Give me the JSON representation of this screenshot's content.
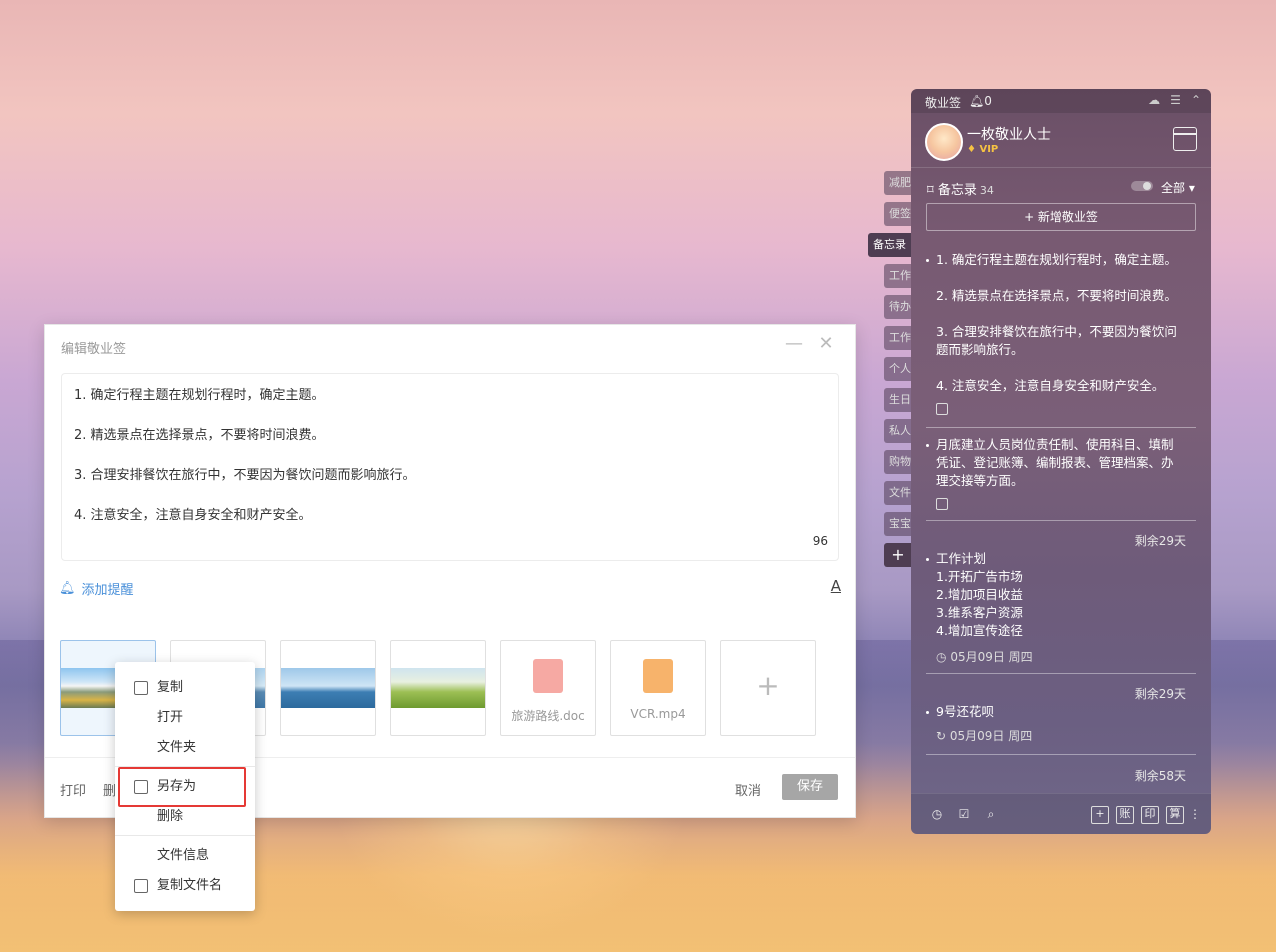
{
  "editor": {
    "title": "编辑敬业签",
    "lines": [
      "1. 确定行程主题在规划行程时，确定主题。",
      "2. 精选景点在选择景点，不要将时间浪费。",
      "3. 合理安排餐饮在旅行中，不要因为餐饮问题而影响旅行。",
      "4. 注意安全，注意自身安全和财产安全。"
    ],
    "char_count": "96",
    "add_reminder": "添加提醒",
    "font_button": "A",
    "attachments": [
      {
        "type": "image",
        "scene": "mountain"
      },
      {
        "type": "image",
        "scene": "sea"
      },
      {
        "type": "image",
        "scene": "boat"
      },
      {
        "type": "image",
        "scene": "field"
      },
      {
        "type": "file",
        "name": "旅游路线.doc",
        "icon": "doc-icon"
      },
      {
        "type": "file",
        "name": "VCR.mp4",
        "icon": "video-icon"
      }
    ],
    "add_attachment": "+",
    "print": "打印",
    "delete_partial": "删",
    "cancel": "取消",
    "save": "保存",
    "colors": {
      "doc": "#f28b82",
      "video": "#f5a04a",
      "link": "#4a90d9",
      "save_bg": "#a6a6a6"
    }
  },
  "context_menu": {
    "items": [
      "复制",
      "打开",
      "文件夹",
      "另存为",
      "删除",
      "文件信息",
      "复制文件名"
    ],
    "highlight": "另存为",
    "highlight_color": "#e53935"
  },
  "panel": {
    "app": "敬业签",
    "notif_count": "0",
    "user": "一枚敬业人士",
    "vip": "VIP",
    "memo": "备忘录",
    "memo_count": "34",
    "filter": "全部",
    "new_button": "+ 新增敬业签",
    "note1": [
      "1. 确定行程主题在规划行程时，确定主题。",
      "2. 精选景点在选择景点，不要将时间浪费。",
      "3. 合理安排餐饮在旅行中，不要因为餐饮问",
      "题而影响旅行。",
      "4. 注意安全，注意自身安全和财产安全。"
    ],
    "note2": [
      "月底建立人员岗位责任制、使用科目、填制",
      "凭证、登记账簿、编制报表、管理档案、办",
      "理交接等方面。"
    ],
    "note3": {
      "remain": "剩余29天",
      "lines": [
        "工作计划",
        "1.开拓广告市场",
        "2.增加项目收益",
        "3.维系客户资源",
        "4.增加宣传途径"
      ],
      "date": "05月09日 周四"
    },
    "note4": {
      "remain": "剩余29天",
      "text": "9号还花呗",
      "date": "05月09日 周四"
    },
    "note5": {
      "remain": "剩余58天"
    },
    "bottom_boxes": [
      "+",
      "账",
      "印",
      "算"
    ]
  },
  "side_tabs": [
    "减肥",
    "便签",
    "备忘录",
    "工作",
    "待办",
    "工作",
    "个人",
    "生日",
    "私人",
    "购物",
    "文件",
    "宝宝",
    "+"
  ],
  "active_tab": "备忘录"
}
